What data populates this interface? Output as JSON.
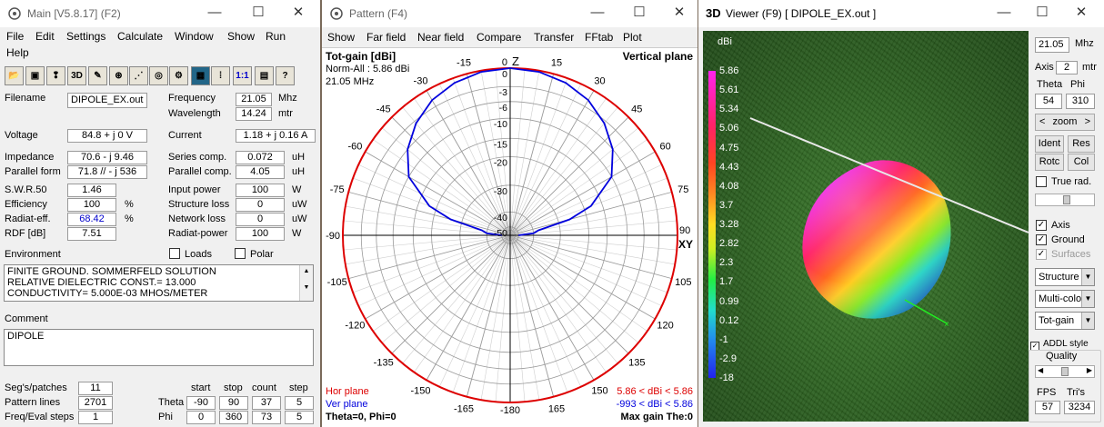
{
  "main": {
    "title": "Main [V5.8.17]  (F2)",
    "menu": [
      "File",
      "Edit",
      "Settings",
      "Calculate",
      "Window",
      "Show",
      "Run",
      "Help"
    ],
    "toolbar": [
      "open-file-icon",
      "save-icon",
      "geometry-icon",
      "3d-view-icon",
      "edit-icon",
      "pattern-icon",
      "segments-icon",
      "antenna-icon",
      "ground-icon",
      "calculator-icon",
      "sweep-icon",
      "ratio-icon",
      "book-icon",
      "help-icon"
    ],
    "tb_3d": "3D",
    "tb_11": "1:1",
    "labels": {
      "filename": "Filename",
      "voltage": "Voltage",
      "impedance": "Impedance",
      "parallel_form": "Parallel form",
      "swr": "S.W.R.50",
      "efficiency": "Efficiency",
      "radiat_eff": "Radiat-eff.",
      "rdf": "RDF [dB]",
      "frequency": "Frequency",
      "wavelength": "Wavelength",
      "current": "Current",
      "series_comp": "Series comp.",
      "parallel_comp": "Parallel comp.",
      "input_power": "Input power",
      "structure_loss": "Structure loss",
      "network_loss": "Network loss",
      "radiat_power": "Radiat-power",
      "environment": "Environment",
      "comment": "Comment",
      "segs": "Seg's/patches",
      "pattern_lines": "Pattern lines",
      "freq_eval": "Freq/Eval steps",
      "start": "start",
      "stop": "stop",
      "count": "count",
      "step": "step",
      "theta": "Theta",
      "phi": "Phi",
      "loads": "Loads",
      "polar": "Polar"
    },
    "units": {
      "mhz": "Mhz",
      "mtr": "mtr",
      "a": "A",
      "uh1": "uH",
      "uh2": "uH",
      "w1": "W",
      "uw1": "uW",
      "uw2": "uW",
      "w2": "W",
      "pct1": "%",
      "pct2": "%"
    },
    "values": {
      "filename": "DIPOLE_EX.out",
      "voltage": "84.8 + j 0 V",
      "impedance": "70.6 - j 9.46",
      "parallel_form": "71.8 // - j 536",
      "swr": "1.46",
      "efficiency": "100",
      "radiat_eff": "68.42",
      "rdf": "7.51",
      "frequency": "21.05",
      "wavelength": "14.24",
      "current": "1.18 + j 0.16 A",
      "series_comp": "0.072",
      "parallel_comp": "4.05",
      "input_power": "100",
      "structure_loss": "0",
      "network_loss": "0",
      "radiat_power": "100",
      "segs": "11",
      "pattern_lines": "2701",
      "freq_eval": "1",
      "theta_start": "-90",
      "theta_stop": "90",
      "theta_count": "37",
      "theta_step": "5",
      "phi_start": "0",
      "phi_stop": "360",
      "phi_count": "73",
      "phi_step": "5"
    },
    "environment": [
      "FINITE GROUND.  SOMMERFELD SOLUTION",
      "RELATIVE DIELECTRIC CONST.= 13.000",
      "CONDUCTIVITY= 5.000E-03 MHOS/METER"
    ],
    "comment": "DIPOLE"
  },
  "pattern": {
    "title": "Pattern   (F4)",
    "menu": [
      "Show",
      "Far field",
      "Near field",
      "Compare",
      "Transfer",
      "FFtab",
      "Plot"
    ],
    "tl1": "Tot-gain [dBi]",
    "tl2": "Norm-All : 5.86 dBi",
    "tl3": "21.05 MHz",
    "tr": "Vertical plane",
    "bl1": "Hor plane",
    "bl2": "Ver plane",
    "bl3": "Theta=0, Phi=0",
    "br1": "5.86 < dBi < 5.86",
    "br2": "-993 < dBi < 5.86",
    "br3": "Max gain The:0",
    "z_label": "Z",
    "xy_label": "XY",
    "colors": {
      "hor": "#dd0000",
      "ver": "#0000dd"
    },
    "chart_data": {
      "type": "polar",
      "angle_labels": [
        "0",
        "15",
        "30",
        "45",
        "60",
        "75",
        "90",
        "105",
        "120",
        "135",
        "150",
        "165",
        "-180",
        "-165",
        "-150",
        "-135",
        "-120",
        "-105",
        "-90",
        "-75",
        "-60",
        "-45",
        "-30",
        "-15"
      ],
      "radial_labels": [
        "0",
        "-3",
        "-6",
        "-10",
        "-15",
        "-20",
        "-30",
        "-40",
        "-50"
      ],
      "series": [
        {
          "name": "Hor plane",
          "color": "#dd0000",
          "gain_dbi": 5.86
        },
        {
          "name": "Ver plane",
          "color": "#0000dd",
          "theta_deg": [
            -90,
            -85,
            -80,
            -75,
            -70,
            -60,
            -50,
            -40,
            -30,
            -20,
            -10,
            0,
            10,
            20,
            30,
            40,
            50,
            60,
            70,
            75,
            80,
            85,
            90
          ],
          "gain_db": [
            -50,
            -40,
            -38,
            -26,
            -18,
            -10,
            -6,
            -3.5,
            -1.8,
            -0.8,
            -0.2,
            0,
            -0.2,
            -0.8,
            -1.8,
            -3.5,
            -6,
            -10,
            -18,
            -26,
            -38,
            -40,
            -50
          ]
        }
      ]
    }
  },
  "viewer": {
    "title": "3D",
    "title_rest": "Viewer (F9)    [  DIPOLE_EX.out ]",
    "freq": "21.05",
    "freq_unit": "Mhz",
    "axis_label": "Axis",
    "axis_value": "2",
    "axis_unit": "mtr",
    "theta_label": "Theta",
    "phi_label": "Phi",
    "theta_value": "54",
    "phi_value": "310",
    "zoom": "zoom",
    "zoom_left": "<",
    "zoom_right": ">",
    "ident": "Ident",
    "res": "Res",
    "rotc": "Rotc",
    "col": "Col",
    "true_rad": "True rad.",
    "chk_axis": "Axis",
    "chk_ground": "Ground",
    "chk_surfaces": "Surfaces",
    "structure": "Structure",
    "multicolor": "Multi-colo",
    "totgain": "Tot-gain",
    "addl": "ADDL style",
    "quality": "Quality",
    "fps_label": "FPS",
    "tris_label": "Tri's",
    "fps": "57",
    "tris": "3234",
    "legend_unit": "dBi",
    "legend": [
      "5.86",
      "5.61",
      "5.34",
      "5.06",
      "4.75",
      "4.43",
      "4.08",
      "3.7",
      "3.28",
      "2.82",
      "2.3",
      "1.7",
      "0.99",
      "0.12",
      "-1",
      "-2.9",
      "-18"
    ],
    "colors": {
      "ground": "#2e6a22"
    }
  }
}
